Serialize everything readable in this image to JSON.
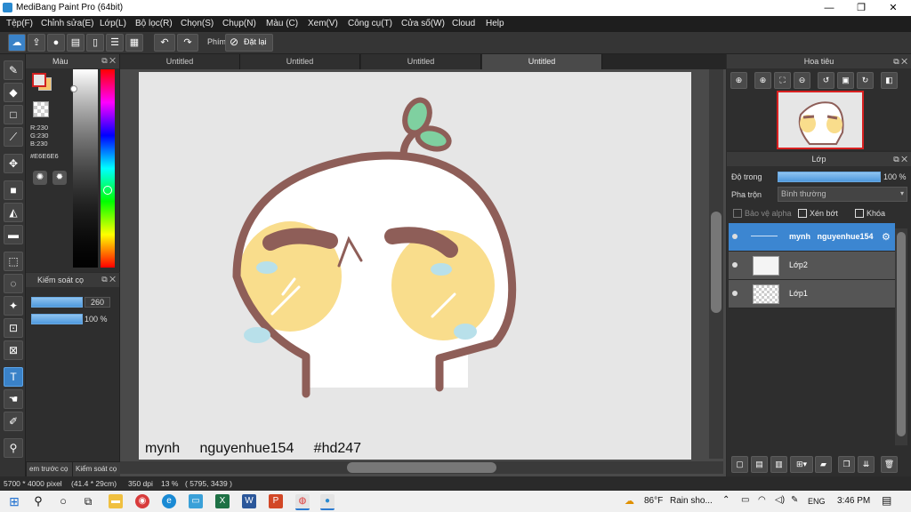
{
  "window": {
    "title": "MediBang Paint Pro (64bit)",
    "minimize": "—",
    "maximize": "❐",
    "close": "✕"
  },
  "menu": [
    "Tệp(F)",
    "Chỉnh sửa(E)",
    "Lớp(L)",
    "Bộ lọc(R)",
    "Chọn(S)",
    "Chụp(N)",
    "Màu (C)",
    "Xem(V)",
    "Công cụ(T)",
    "Cửa số(W)",
    "Cloud",
    "Help"
  ],
  "toolbar": {
    "phim_label": "Phím",
    "reset_label": "Đặt lại"
  },
  "color_panel": {
    "title": "Màu",
    "rgb_r": "R:230",
    "rgb_g": "G:230",
    "rgb_b": "B:230",
    "hex": "#E6E6E6",
    "primary_color": "#E6E6E6",
    "secondary_color": "#F5C26B",
    "accent": "#d02020"
  },
  "control_panel": {
    "title": "Kiếm soát cọ",
    "size_value": "260",
    "opacity_value": "100 %"
  },
  "bottom_tabs": [
    "em trước cọ",
    "Kiểm soát cọ"
  ],
  "document_tabs": [
    "Untitled",
    "Untitled",
    "Untitled",
    "Untitled"
  ],
  "canvas": {
    "caption": "mynh   nguyenhue154   #hd247",
    "background": "#E6E6E6"
  },
  "navigator": {
    "title": "Hoa tiêu"
  },
  "layers": {
    "title": "Lớp",
    "opacity_label": "Độ trong",
    "opacity_value": "100 %",
    "blend_label": "Pha trộn",
    "blend_value": "Bình thường",
    "protect_alpha": "Bảo vệ alpha",
    "clipping": "Xén bớt",
    "lock": "Khóa",
    "items": [
      {
        "name": "mynh   nguyenhue154"
      },
      {
        "name": "Lớp2"
      },
      {
        "name": "Lớp1"
      }
    ]
  },
  "status": {
    "size_px": "5700 * 4000 pixel",
    "size_cm": "(41.4 * 29cm)",
    "dpi": "350 dpi",
    "zoom": "13 %",
    "coords": "( 5795, 3439 )"
  },
  "taskbar": {
    "weather_temp": "86°F",
    "weather_text": "Rain sho...",
    "lang": "ENG",
    "time": "3:46 PM"
  }
}
